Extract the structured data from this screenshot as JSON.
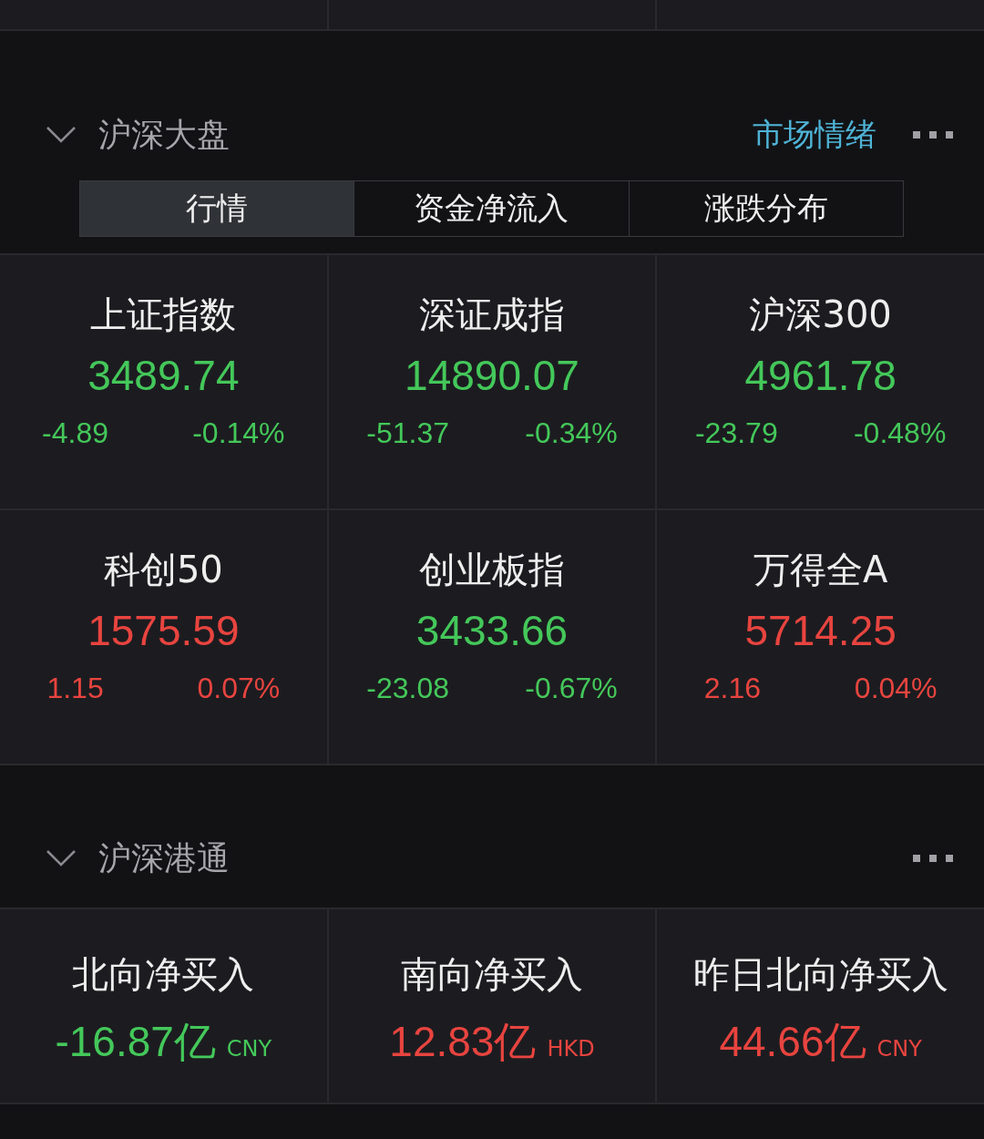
{
  "sections": [
    {
      "title": "沪深大盘",
      "expanded": true,
      "link": "市场情绪",
      "tabs": [
        {
          "label": "行情",
          "selected": true
        },
        {
          "label": "资金净流入",
          "selected": false
        },
        {
          "label": "涨跌分布",
          "selected": false
        }
      ],
      "cells": [
        {
          "kind": "index",
          "color": "#44c85a",
          "name": "上证指数",
          "value": "3489.74",
          "change": "-4.89",
          "percent": "-0.14%"
        },
        {
          "kind": "index",
          "color": "#44c85a",
          "name": "深证成指",
          "value": "14890.07",
          "change": "-51.37",
          "percent": "-0.34%"
        },
        {
          "kind": "index",
          "color": "#44c85a",
          "name": "沪深300",
          "value": "4961.78",
          "change": "-23.79",
          "percent": "-0.48%"
        },
        {
          "kind": "index",
          "color": "#e8443f",
          "name": "科创50",
          "value": "1575.59",
          "change": "1.15",
          "percent": "0.07%"
        },
        {
          "kind": "index",
          "color": "#44c85a",
          "name": "创业板指",
          "value": "3433.66",
          "change": "-23.08",
          "percent": "-0.67%"
        },
        {
          "kind": "index",
          "color": "#e8443f",
          "name": "万得全A",
          "value": "5714.25",
          "change": "2.16",
          "percent": "0.04%"
        }
      ]
    },
    {
      "title": "沪深港通",
      "expanded": true,
      "cells": [
        {
          "kind": "flow",
          "color": "#44c85a",
          "name": "北向净买入",
          "value": "-16.87亿",
          "currency": "CNY"
        },
        {
          "kind": "flow",
          "color": "#e8443f",
          "name": "南向净买入",
          "value": "12.83亿",
          "currency": "HKD"
        },
        {
          "kind": "flow",
          "color": "#e8443f",
          "name": "昨日北向净买入",
          "value": "44.66亿",
          "currency": "CNY"
        }
      ]
    }
  ]
}
